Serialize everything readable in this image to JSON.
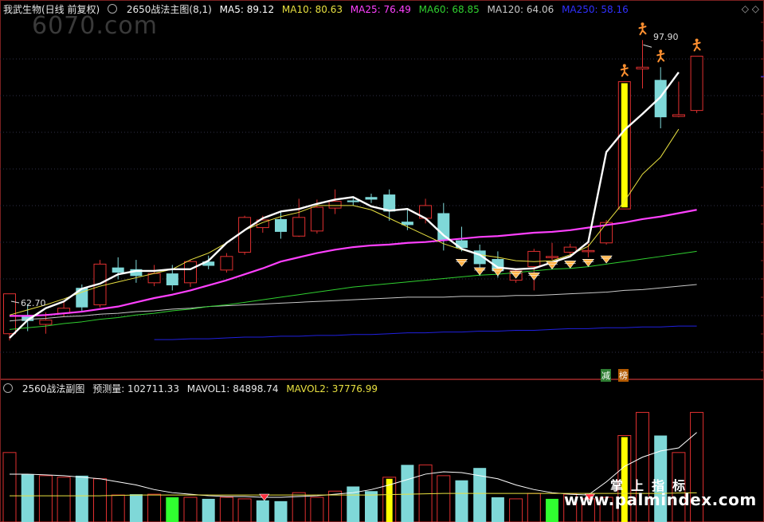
{
  "main_header": {
    "stock_name": "我武生物(日线 前复权)",
    "indicator_name": "2650战法主图(8,1)",
    "ma5": "MA5: 89.12",
    "ma10": "MA10: 80.63",
    "ma25": "MA25: 76.49",
    "ma60": "MA60: 68.85",
    "ma120": "MA120: 64.06",
    "ma250": "MA250: 58.16"
  },
  "sub_header": {
    "indicator_name": "2560战法副图",
    "forecast_volume": "预测量: 102711.33",
    "mavol1": "MAVOL1: 84898.74",
    "mavol2": "MAVOL2: 37776.99"
  },
  "annotations": {
    "price_max": "97.90",
    "price_min": "62.70",
    "tag_jian": "减",
    "tag_bang": "榜"
  },
  "watermarks": {
    "top": "6070.com",
    "bottom": "www.palmindex.com",
    "bottom_cn": "掌上指标"
  },
  "window_controls": "◇ ◇",
  "colors": {
    "background": "#000000",
    "up": "#e03030",
    "down": "#7fd8d8",
    "ma5": "#ffffff",
    "ma10": "#e8e040",
    "ma25": "#ff40ff",
    "ma60": "#30d030",
    "ma120": "#c8c8c8",
    "ma250": "#2020e0",
    "grid": "#303048"
  },
  "chart_data": {
    "type": "candlestick",
    "price_axis_range": [
      60,
      100
    ],
    "candles": [
      {
        "o": 63.5,
        "c": 68.2,
        "h": 68.2,
        "l": 62.7,
        "d": "up"
      },
      {
        "o": 65.7,
        "c": 65.0,
        "h": 67.0,
        "l": 63.8,
        "d": "down"
      },
      {
        "o": 64.6,
        "c": 65.1,
        "h": 66.0,
        "l": 63.5,
        "d": "up"
      },
      {
        "o": 65.9,
        "c": 66.5,
        "h": 67.3,
        "l": 65.5,
        "d": "up"
      },
      {
        "o": 68.9,
        "c": 66.6,
        "h": 69.3,
        "l": 66.2,
        "d": "down"
      },
      {
        "o": 66.9,
        "c": 71.7,
        "h": 72.2,
        "l": 66.6,
        "d": "up"
      },
      {
        "o": 71.3,
        "c": 70.7,
        "h": 72.5,
        "l": 69.9,
        "d": "down"
      },
      {
        "o": 71.1,
        "c": 70.3,
        "h": 72.2,
        "l": 69.5,
        "d": "down"
      },
      {
        "o": 69.5,
        "c": 70.6,
        "h": 71.6,
        "l": 69.1,
        "d": "up"
      },
      {
        "o": 70.6,
        "c": 69.2,
        "h": 71.6,
        "l": 68.6,
        "d": "down"
      },
      {
        "o": 69.5,
        "c": 72.0,
        "h": 72.2,
        "l": 69.0,
        "d": "up"
      },
      {
        "o": 72.0,
        "c": 71.5,
        "h": 72.7,
        "l": 71.1,
        "d": "down"
      },
      {
        "o": 71.0,
        "c": 72.6,
        "h": 73.0,
        "l": 70.7,
        "d": "up"
      },
      {
        "o": 73.1,
        "c": 77.2,
        "h": 77.4,
        "l": 72.8,
        "d": "up"
      },
      {
        "o": 76.0,
        "c": 76.9,
        "h": 77.4,
        "l": 75.4,
        "d": "up"
      },
      {
        "o": 77.0,
        "c": 75.5,
        "h": 77.9,
        "l": 74.7,
        "d": "down"
      },
      {
        "o": 75.0,
        "c": 77.2,
        "h": 79.4,
        "l": 74.9,
        "d": "up"
      },
      {
        "o": 75.6,
        "c": 78.4,
        "h": 79.3,
        "l": 75.3,
        "d": "up"
      },
      {
        "o": 78.3,
        "c": 79.1,
        "h": 80.5,
        "l": 77.6,
        "d": "up"
      },
      {
        "o": 79.0,
        "c": 79.2,
        "h": 79.5,
        "l": 78.6,
        "d": "down"
      },
      {
        "o": 79.3,
        "c": 79.6,
        "h": 80.0,
        "l": 78.9,
        "d": "down"
      },
      {
        "o": 79.9,
        "c": 77.9,
        "h": 80.5,
        "l": 76.8,
        "d": "down"
      },
      {
        "o": 76.7,
        "c": 76.3,
        "h": 78.3,
        "l": 75.7,
        "d": "down"
      },
      {
        "o": 77.1,
        "c": 78.6,
        "h": 79.4,
        "l": 76.5,
        "d": "up"
      },
      {
        "o": 77.7,
        "c": 74.5,
        "h": 78.9,
        "l": 73.3,
        "d": "down"
      },
      {
        "o": 74.5,
        "c": 73.6,
        "h": 76.1,
        "l": 73.2,
        "d": "down"
      },
      {
        "o": 73.3,
        "c": 71.7,
        "h": 74.0,
        "l": 70.3,
        "d": "down"
      },
      {
        "o": 72.3,
        "c": 70.9,
        "h": 73.2,
        "l": 70.1,
        "d": "down"
      },
      {
        "o": 69.8,
        "c": 70.9,
        "h": 71.2,
        "l": 69.5,
        "d": "up"
      },
      {
        "o": 71.4,
        "c": 73.2,
        "h": 73.5,
        "l": 68.6,
        "d": "up"
      },
      {
        "o": 72.5,
        "c": 72.6,
        "h": 74.2,
        "l": 72.2,
        "d": "up"
      },
      {
        "o": 73.1,
        "c": 73.7,
        "h": 74.1,
        "l": 72.5,
        "d": "up"
      },
      {
        "o": 73.2,
        "c": 73.3,
        "h": 74.1,
        "l": 72.5,
        "d": "up"
      },
      {
        "o": 74.2,
        "c": 76.6,
        "h": 76.9,
        "l": 74.0,
        "d": "up"
      },
      {
        "o": 78.2,
        "c": 93.2,
        "h": 93.2,
        "l": 78.2,
        "d": "up",
        "hl": true
      },
      {
        "o": 94.7,
        "c": 94.9,
        "h": 98.1,
        "l": 92.4,
        "d": "up"
      },
      {
        "o": 93.4,
        "c": 89.0,
        "h": 94.9,
        "l": 87.7,
        "d": "down"
      },
      {
        "o": 89.1,
        "c": 89.3,
        "h": 93.2,
        "l": 89.0,
        "d": "up"
      },
      {
        "o": 89.8,
        "c": 96.2,
        "h": 96.2,
        "l": 89.5,
        "d": "up"
      }
    ],
    "ma5": [
      63.0,
      65.1,
      66.5,
      67.3,
      68.8,
      69.4,
      70.5,
      70.9,
      70.9,
      71.1,
      71.1,
      72.1,
      74.2,
      75.7,
      77.1,
      77.9,
      78.2,
      78.8,
      79.3,
      79.6,
      78.5,
      78.0,
      78.2,
      77.1,
      75.1,
      73.5,
      72.8,
      71.3,
      71.1,
      71.2,
      71.9,
      72.6,
      74.3,
      84.9,
      87.5,
      89.4,
      91.4,
      94.3
    ],
    "ma10": [
      65.7,
      66.3,
      66.9,
      67.6,
      68.4,
      69.1,
      69.6,
      70.1,
      70.6,
      71.1,
      72.2,
      73.0,
      74.2,
      75.7,
      76.6,
      77.3,
      77.8,
      78.6,
      78.6,
      78.6,
      78.1,
      77.1,
      76.1,
      75.1,
      74.1,
      73.4,
      72.8,
      72.5,
      72.1,
      72.0,
      72.1,
      72.8,
      73.8,
      76.5,
      79.1,
      82.3,
      84.3,
      87.6
    ],
    "ma25": [
      65.6,
      65.6,
      65.7,
      65.9,
      66.1,
      66.4,
      66.7,
      67.2,
      67.7,
      68.1,
      68.6,
      69.2,
      69.8,
      70.5,
      71.2,
      72.0,
      72.5,
      73.0,
      73.4,
      73.7,
      73.9,
      74.0,
      74.2,
      74.3,
      74.5,
      74.7,
      74.9,
      75.0,
      75.2,
      75.4,
      75.5,
      75.7,
      76.0,
      76.3,
      76.6,
      77.0,
      77.3,
      77.7,
      78.1
    ],
    "ma60": [
      64.0,
      64.2,
      64.4,
      64.7,
      64.9,
      65.2,
      65.4,
      65.7,
      65.9,
      66.2,
      66.4,
      66.7,
      66.9,
      67.2,
      67.5,
      67.8,
      68.1,
      68.4,
      68.7,
      69.0,
      69.2,
      69.4,
      69.6,
      69.8,
      70.0,
      70.2,
      70.4,
      70.5,
      70.7,
      70.9,
      71.1,
      71.2,
      71.4,
      71.7,
      72.0,
      72.3,
      72.6,
      72.9,
      73.2
    ],
    "ma120": [
      65.0,
      65.2,
      65.3,
      65.5,
      65.6,
      65.8,
      65.9,
      66.1,
      66.2,
      66.4,
      66.5,
      66.7,
      66.8,
      66.9,
      67.0,
      67.1,
      67.2,
      67.3,
      67.4,
      67.5,
      67.6,
      67.7,
      67.8,
      67.8,
      67.8,
      67.9,
      67.9,
      67.9,
      68.0,
      68.0,
      68.1,
      68.2,
      68.3,
      68.4,
      68.6,
      68.7,
      68.9,
      69.1,
      69.3
    ],
    "ma250_start_index": 8,
    "ma250": [
      62.8,
      62.8,
      62.9,
      62.9,
      63.0,
      63.1,
      63.1,
      63.2,
      63.2,
      63.3,
      63.3,
      63.4,
      63.4,
      63.5,
      63.6,
      63.6,
      63.7,
      63.7,
      63.8,
      63.8,
      63.9,
      63.9,
      64.0,
      64.1,
      64.1,
      64.2,
      64.2,
      64.3,
      64.3,
      64.4,
      64.4
    ],
    "signal_people_at": [
      34,
      35,
      36,
      38
    ],
    "diamonds": [
      {
        "i": 25,
        "p": 71.9
      },
      {
        "i": 26,
        "p": 70.9
      },
      {
        "i": 27,
        "p": 70.8
      },
      {
        "i": 28,
        "p": 70.5
      },
      {
        "i": 29,
        "p": 70.3
      },
      {
        "i": 30,
        "p": 71.6
      },
      {
        "i": 31,
        "p": 71.7
      },
      {
        "i": 32,
        "p": 71.9
      },
      {
        "i": 33,
        "p": 72.3
      }
    ],
    "volume": {
      "axis_max": 160000,
      "bars": [
        {
          "v": 90000,
          "d": "up"
        },
        {
          "v": 62000,
          "d": "down"
        },
        {
          "v": 60000,
          "d": "up"
        },
        {
          "v": 58000,
          "d": "up"
        },
        {
          "v": 60000,
          "d": "down"
        },
        {
          "v": 56000,
          "d": "up"
        },
        {
          "v": 35000,
          "d": "up"
        },
        {
          "v": 36000,
          "d": "down"
        },
        {
          "v": 36000,
          "d": "up"
        },
        {
          "v": 32000,
          "d": "green"
        },
        {
          "v": 32000,
          "d": "up"
        },
        {
          "v": 30000,
          "d": "down"
        },
        {
          "v": 32000,
          "d": "up"
        },
        {
          "v": 30000,
          "d": "up"
        },
        {
          "v": 28000,
          "d": "down"
        },
        {
          "v": 27000,
          "d": "down"
        },
        {
          "v": 38000,
          "d": "up"
        },
        {
          "v": 32000,
          "d": "up"
        },
        {
          "v": 40000,
          "d": "up"
        },
        {
          "v": 46000,
          "d": "down"
        },
        {
          "v": 40000,
          "d": "down"
        },
        {
          "v": 58000,
          "d": "yellow"
        },
        {
          "v": 74000,
          "d": "down"
        },
        {
          "v": 74000,
          "d": "up"
        },
        {
          "v": 60000,
          "d": "up"
        },
        {
          "v": 54000,
          "d": "down"
        },
        {
          "v": 70000,
          "d": "down"
        },
        {
          "v": 32000,
          "d": "down"
        },
        {
          "v": 30000,
          "d": "up"
        },
        {
          "v": 37000,
          "d": "up"
        },
        {
          "v": 30000,
          "d": "green"
        },
        {
          "v": 36000,
          "d": "up"
        },
        {
          "v": 30000,
          "d": "up"
        },
        {
          "v": 32000,
          "d": "up"
        },
        {
          "v": 112000,
          "d": "yellow"
        },
        {
          "v": 142000,
          "d": "up"
        },
        {
          "v": 112000,
          "d": "down"
        },
        {
          "v": 90000,
          "d": "up"
        },
        {
          "v": 142000,
          "d": "up"
        }
      ],
      "mavol1": [
        62000,
        62000,
        61000,
        60000,
        58000,
        56000,
        52000,
        48000,
        42000,
        38000,
        36000,
        34000,
        33000,
        33000,
        32000,
        32000,
        33000,
        34000,
        36000,
        38000,
        42000,
        48000,
        55000,
        62000,
        65000,
        64000,
        60000,
        56000,
        48000,
        42000,
        38000,
        36000,
        35000,
        52000,
        72000,
        84000,
        92000,
        96000,
        116000
      ],
      "mavol2": [
        34000,
        34000,
        34000,
        34000,
        34000,
        34000,
        34500,
        35000,
        35000,
        35000,
        35000,
        35000,
        35000,
        35000,
        35000,
        35000,
        35000,
        35000,
        35000,
        35000,
        35000,
        35500,
        36000,
        36500,
        37000,
        37000,
        37000,
        37000,
        37000,
        37000,
        37000,
        37000,
        37000,
        37000,
        37000,
        37000,
        37000,
        37500,
        37800
      ],
      "red_gem_at": [
        14,
        32
      ]
    }
  }
}
